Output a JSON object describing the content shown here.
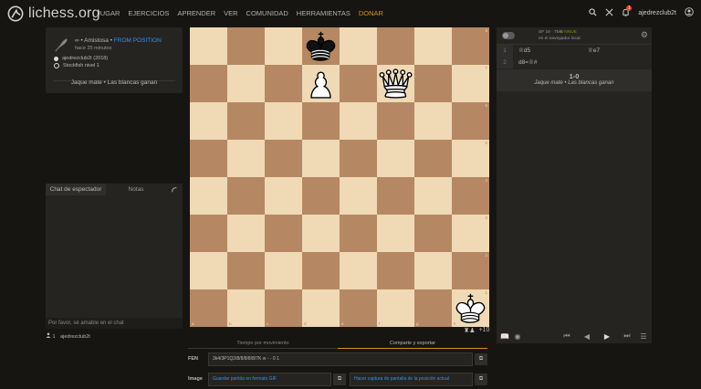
{
  "header": {
    "logo_text": "lichess.org",
    "nav": [
      "JUGAR",
      "EJERCICIOS",
      "APRENDER",
      "VER",
      "COMUNIDAD",
      "HERRAMIENTAS"
    ],
    "donate": "DONAR",
    "notification_count": "1",
    "username": "ajedrezclub2t"
  },
  "game_info": {
    "mode_prefix": "∞ • Amistosa •",
    "from_position": "FROM POSITION",
    "time_ago": "hace 25 minutos",
    "white_player": "ajedrezclub2t (2018)",
    "black_player": "Stockfish nivel 1",
    "result": "Jaque mate • Las blancas ganan"
  },
  "chat": {
    "tab_chat": "Chat de espectador",
    "tab_notes": "Notas",
    "placeholder": "Por favor, sé amable en el chat"
  },
  "spectators": {
    "count": "1",
    "names": "ajedrezclub2t"
  },
  "board": {
    "orientation": "white",
    "files": [
      "a",
      "b",
      "c",
      "d",
      "e",
      "f",
      "g",
      "h"
    ],
    "ranks": [
      "8",
      "7",
      "6",
      "5",
      "4",
      "3",
      "2",
      "1"
    ],
    "pieces": [
      {
        "square": "d8",
        "piece": "black-king"
      },
      {
        "square": "d7",
        "piece": "white-pawn"
      },
      {
        "square": "f7",
        "piece": "white-queen"
      },
      {
        "square": "h1",
        "piece": "white-king"
      }
    ],
    "clock_extra": "+10"
  },
  "engine": {
    "name": "SF 16 · 7MB",
    "nnue": "NNUE",
    "location": "en el navegador local"
  },
  "moves": [
    {
      "num": "1",
      "white": "♕d5",
      "black": "♕e7"
    },
    {
      "num": "2",
      "white": "d8=♕#",
      "black": ""
    }
  ],
  "result": {
    "score": "1-0",
    "description": "Jaque mate • Las blancas ganan"
  },
  "share": {
    "tab_move_times": "Tiempo por movimiento",
    "tab_share": "Comparte y exportar",
    "fen_label": "FEN",
    "fen": "3k4/3P1Q2/8/8/8/8/8/7K w - - 0 1",
    "image_label": "Image",
    "gif_button": "Guardar partida en formato GIF",
    "screenshot_button": "Hacer captura de pantalla de la posición actual"
  },
  "colors": {
    "light_square": "#f0d9b5",
    "dark_square": "#b58863",
    "link": "#3692e7",
    "donate": "#d59120"
  }
}
